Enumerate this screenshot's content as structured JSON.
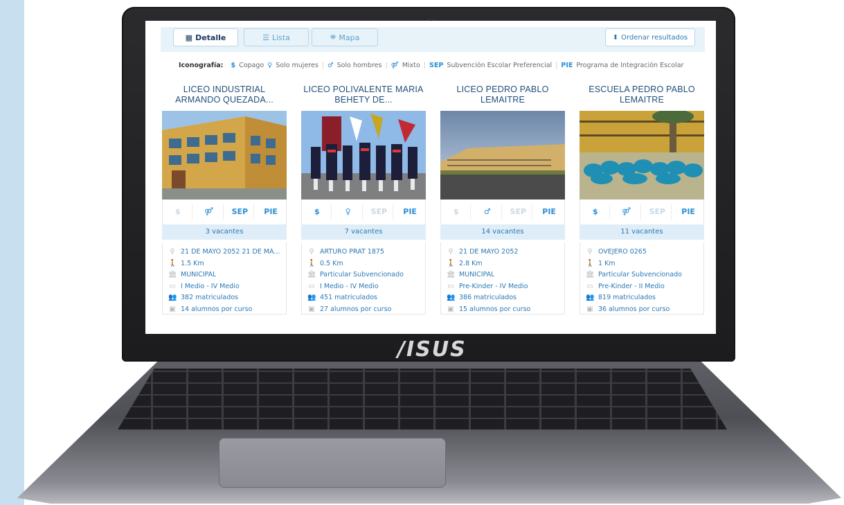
{
  "view_tabs": [
    {
      "label": "Detalle",
      "icon": "grid-icon",
      "active": true
    },
    {
      "label": "Lista",
      "icon": "list-icon",
      "active": false
    },
    {
      "label": "Mapa",
      "icon": "map-icon",
      "active": false
    }
  ],
  "sort_label": "Ordenar resultados",
  "legend": {
    "title": "Iconografía:",
    "copago": "Copago",
    "mujeres": "Solo mujeres",
    "hombres": "Solo hombres",
    "mixto": "Mixto",
    "sep_code": "SEP",
    "sep_text": "Subvención Escolar Preferencial",
    "pie_code": "PIE",
    "pie_text": "Programa de Integración Escolar"
  },
  "schools": [
    {
      "title": "LICEO INDUSTRIAL ARMANDO QUEZADA...",
      "flags": {
        "copago": false,
        "gender": "mixto",
        "sep": true,
        "pie": true
      },
      "vacantes": "3 vacantes",
      "address": "21 DE MAYO 2052 21 DE MA...",
      "distance": "1.5 Km",
      "dependency": "MUNICIPAL",
      "levels": "I Medio - IV Medio",
      "enrolled": "382 matriculados",
      "per_course": "14 alumnos por curso",
      "photo": "building"
    },
    {
      "title": "LICEO POLIVALENTE MARIA BEHETY DE...",
      "flags": {
        "copago": true,
        "gender": "mujeres",
        "sep": false,
        "pie": true
      },
      "vacantes": "7 vacantes",
      "address": "ARTURO PRAT 1875",
      "distance": "0.5 Km",
      "dependency": "Particular Subvencionado",
      "levels": "I Medio - IV Medio",
      "enrolled": "451 matriculados",
      "per_course": "27 alumnos por curso",
      "photo": "parade"
    },
    {
      "title": "LICEO PEDRO PABLO LEMAITRE",
      "flags": {
        "copago": false,
        "gender": "hombres",
        "sep": false,
        "pie": true
      },
      "vacantes": "14 vacantes",
      "address": "21 DE MAYO 2052",
      "distance": "2.8 Km",
      "dependency": "MUNICIPAL",
      "levels": "Pre-Kinder - IV Medio",
      "enrolled": "386 matriculados",
      "per_course": "15 alumnos por curso",
      "photo": "campus"
    },
    {
      "title": "ESCUELA PEDRO PABLO LEMAITRE",
      "flags": {
        "copago": true,
        "gender": "mixto",
        "sep": false,
        "pie": true
      },
      "vacantes": "11 vacantes",
      "address": "OVEJERO 0265",
      "distance": "1 Km",
      "dependency": "Particular Subvencionado",
      "levels": "Pre-Kinder - II Medio",
      "enrolled": "819 matriculados",
      "per_course": "36 alumnos por curso",
      "photo": "group"
    }
  ],
  "brand": "/ISUS",
  "colors": {
    "accent": "#2a8fd6",
    "title": "#1f4e79",
    "vacantes_bg": "#deedf7"
  }
}
